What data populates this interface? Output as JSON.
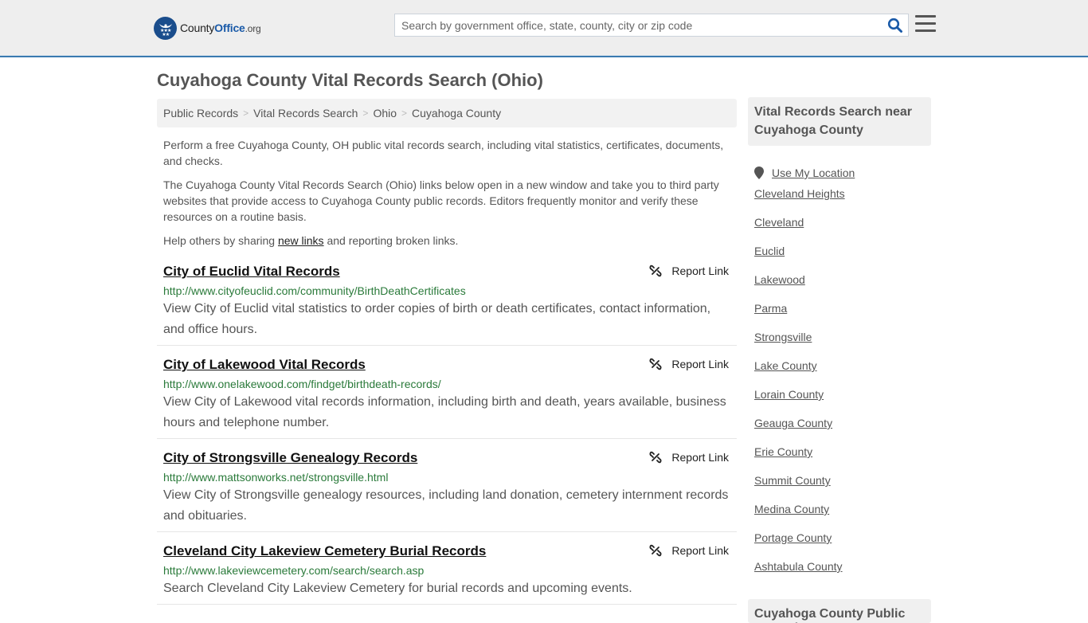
{
  "header": {
    "logo": {
      "name": "County",
      "brand": "Office",
      "tld": ".org"
    },
    "search": {
      "placeholder": "Search by government office, state, county, city or zip code",
      "value": ""
    },
    "icons": {
      "logo": "eagle-stars-badge-icon",
      "search": "search-icon",
      "menu": "hamburger-menu-icon"
    }
  },
  "page": {
    "title": "Cuyahoga County Vital Records Search (Ohio)"
  },
  "breadcrumb": {
    "separator": ">",
    "items": [
      "Public Records",
      "Vital Records Search",
      "Ohio",
      "Cuyahoga County"
    ]
  },
  "intro": {
    "p1": "Perform a free Cuyahoga County, OH public vital records search, including vital statistics, certificates, documents, and checks.",
    "p2": "The Cuyahoga County Vital Records Search (Ohio) links below open in a new window and take you to third party websites that provide access to Cuyahoga County public records. Editors frequently monitor and verify these resources on a routine basis.",
    "p3_before": "Help others by sharing ",
    "p3_link": "new links",
    "p3_after": " and reporting broken links."
  },
  "results": [
    {
      "title": "City of Euclid Vital Records",
      "url": "http://www.cityofeuclid.com/community/BirthDeathCertificates",
      "description": "View City of Euclid vital statistics to order copies of birth or death certificates, contact information, and office hours.",
      "report_label": "Report Link"
    },
    {
      "title": "City of Lakewood Vital Records",
      "url": "http://www.onelakewood.com/findget/birthdeath-records/",
      "description": "View City of Lakewood vital records information, including birth and death, years available, business hours and telephone number.",
      "report_label": "Report Link"
    },
    {
      "title": "City of Strongsville Genealogy Records",
      "url": "http://www.mattsonworks.net/strongsville.html",
      "description": "View City of Strongsville genealogy resources, including land donation, cemetery internment records and obituaries.",
      "report_label": "Report Link"
    },
    {
      "title": "Cleveland City Lakeview Cemetery Burial Records",
      "url": "http://www.lakeviewcemetery.com/search/search.asp",
      "description": "Search Cleveland City Lakeview Cemetery for burial records and upcoming events.",
      "report_label": "Report Link"
    }
  ],
  "sidebar": {
    "heading": "Vital Records Search near Cuyahoga County",
    "use_location": "Use My Location",
    "links": [
      "Cleveland Heights",
      "Cleveland",
      "Euclid",
      "Lakewood",
      "Parma",
      "Strongsville",
      "Lake County",
      "Lorain County",
      "Geauga County",
      "Erie County",
      "Summit County",
      "Medina County",
      "Portage County",
      "Ashtabula County"
    ],
    "heading2": "Cuyahoga County Public Records"
  },
  "colors": {
    "accent": "#3a7ab0",
    "brand": "#1a4d8c",
    "url_green": "#2a7a3a"
  }
}
